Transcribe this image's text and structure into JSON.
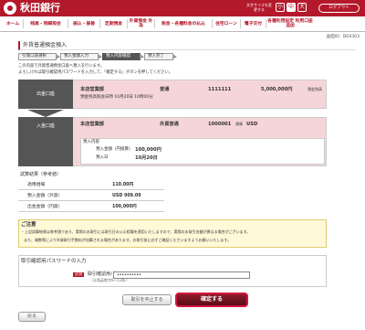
{
  "header": {
    "bank_name": "秋田銀行",
    "font_size_note": "文字サイズを変更する",
    "font_sizes": [
      "小",
      "中",
      "大"
    ],
    "logout": "ログアウト"
  },
  "nav": {
    "items": [
      "ホーム",
      "残高・明細照会",
      "振込・振替",
      "定期預金",
      "外貨預金 外為",
      "税金・各種料金の払込",
      "住宅ローン",
      "電子交付",
      "各種利用設定 利用口座追加"
    ]
  },
  "user_no": "画面ID：BG0303",
  "page_title": "外貨普通預金預入",
  "steps": [
    "引落口座選択",
    "預入金額入力",
    "預入内容確認",
    "預入完了"
  ],
  "instructions": [
    "この内容で外貨普通預金口座へ預入を行います。",
    "よろしければ取引確認用パスワードを入力して、「確定する」ボタンを押してください。"
  ],
  "from_account": {
    "label": "出金口座",
    "branch": "本店営業部",
    "type": "普通",
    "number": "1111111",
    "amount": "5,000,000円",
    "amount_suffix": "預金残高",
    "balance_time": "預金残高照会日時 10月20日 10時00分"
  },
  "to_account": {
    "label": "入金口座",
    "branch": "本店営業部",
    "type": "外貨普通",
    "number": "1000001",
    "currency_label": "通貨",
    "currency": "USD"
  },
  "loan": {
    "title": "預入内容",
    "amount_label": "預入金額（円換算）",
    "amount": "100,000円",
    "date_label": "預入日",
    "date": "10月20日"
  },
  "results": {
    "title": "試算結果（参考値）",
    "rows": [
      {
        "label": "適用相場",
        "value": "110.00円"
      },
      {
        "label": "預入金額（外貨）",
        "value": "USD 909.09"
      },
      {
        "label": "出金金額（円貨）",
        "value": "100,000円"
      }
    ]
  },
  "notice": {
    "title": "ご注意",
    "lines": [
      "・上記試算結果は参考値であり、実際のお取引には取引日の公示相場を適用いたしますので、実際のお取引金額が異なる場合がございます。",
      "また、端数等により外貨取引手数料が加算される場合があります。お取引前に必ずご確認くださいますようお願いいたします。"
    ]
  },
  "password": {
    "section_title": "取引確認用パスワードの入力",
    "required": "必須",
    "label": "取引確認用パスワード",
    "hint": "（半角英数字6〜12桁）",
    "value": "••••••••••"
  },
  "buttons": {
    "cancel": "取引を中止する",
    "confirm": "確定する",
    "back": "戻る"
  }
}
